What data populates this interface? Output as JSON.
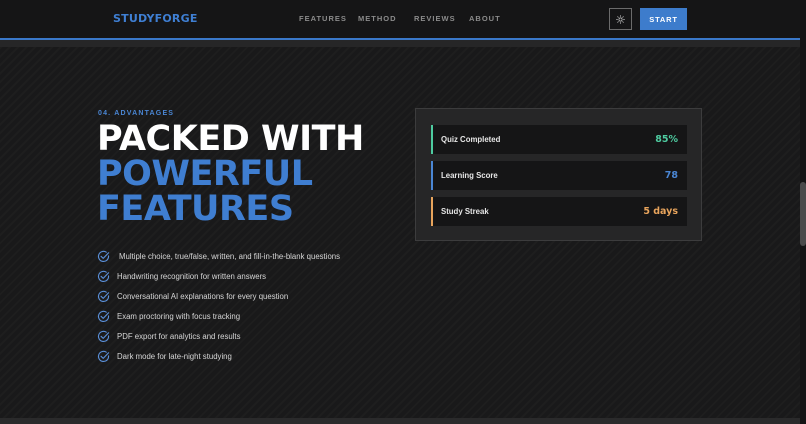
{
  "nav": {
    "logo": "STUDYFORGE",
    "links": [
      "FEATURES",
      "METHOD",
      "REVIEWS",
      "ABOUT"
    ],
    "theme_icon": "sun-icon",
    "start_label": "START"
  },
  "hero": {
    "eyebrow": "04. ADVANTAGES",
    "title_line1": "PACKED WITH",
    "title_line2": "POWERFUL",
    "title_line3": "FEATURES",
    "features": [
      "Multiple choice, true/false, written, and fill-in-the-blank questions",
      "Handwriting recognition for written answers",
      "Conversational AI explanations for every question",
      "Exam proctoring with focus tracking",
      "PDF export for analytics and results",
      "Dark mode for late-night studying"
    ]
  },
  "stats": [
    {
      "label": "Quiz Completed",
      "value": "85%",
      "color": "#4ecba0"
    },
    {
      "label": "Learning Score",
      "value": "78",
      "color": "#4a86d4"
    },
    {
      "label": "Study Streak",
      "value": "5 days",
      "color": "#e8a45c"
    }
  ],
  "colors": {
    "accent": "#3d7ccc",
    "background": "#19191a",
    "check": "#5a8fd8"
  }
}
